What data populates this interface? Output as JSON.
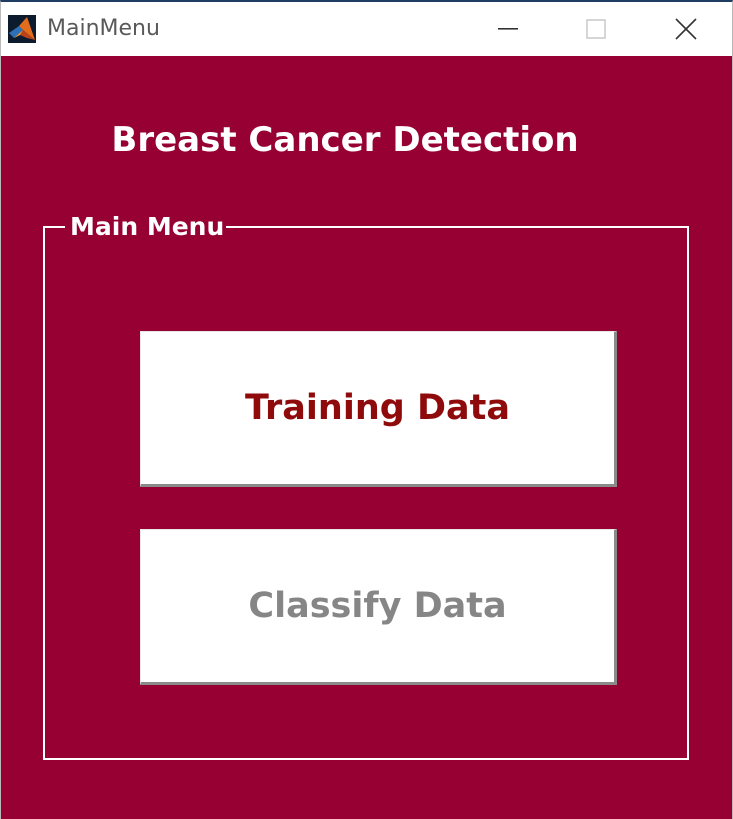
{
  "window": {
    "title": "MainMenu",
    "icon": "matlab-icon",
    "controls": [
      "minimize-icon",
      "maximize-icon",
      "close-icon"
    ]
  },
  "app": {
    "heading": "Breast Cancer Detection"
  },
  "panel": {
    "title": "Main Menu",
    "buttons": {
      "training": {
        "label": "Training Data",
        "enabled": true
      },
      "classify": {
        "label": "Classify Data",
        "enabled": false
      }
    }
  },
  "colors": {
    "background": "#970033",
    "training_text": "#8f0b0b",
    "disabled_text": "#868686",
    "heading_text": "#ffffff"
  }
}
